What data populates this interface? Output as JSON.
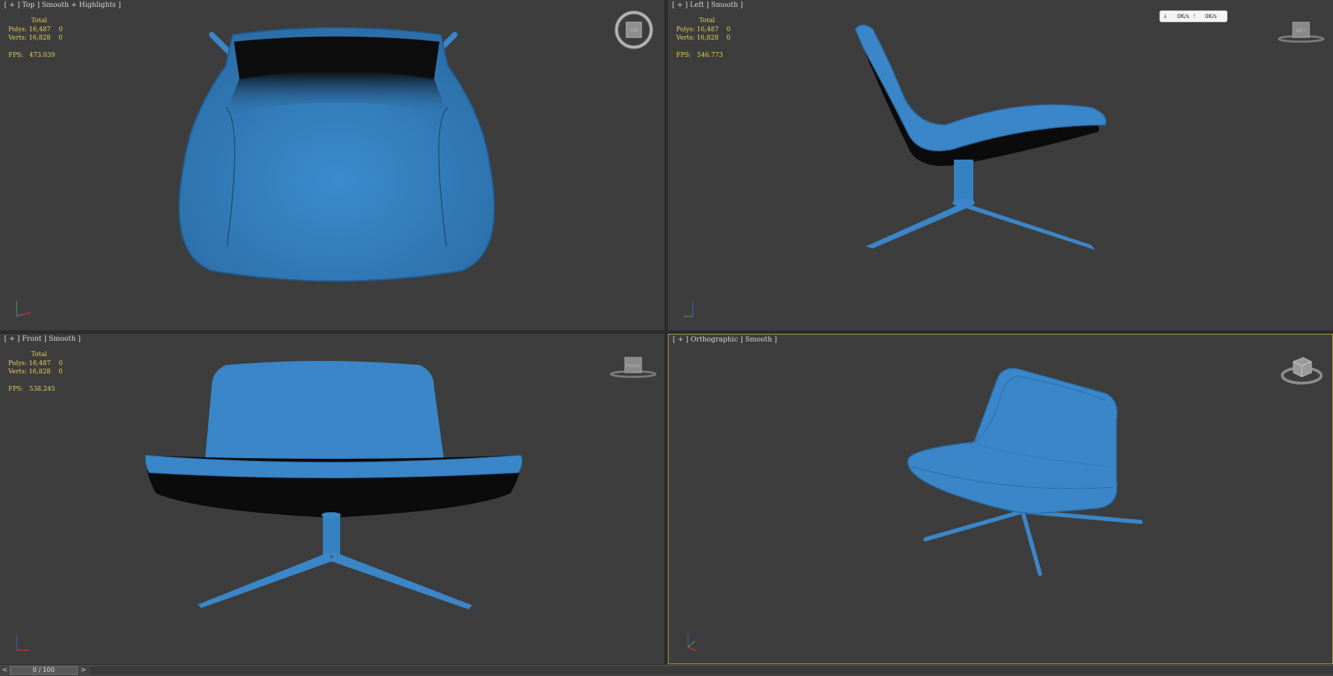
{
  "viewports": {
    "top": {
      "label_prefix": "[ + ] ",
      "view": "Top",
      "sep1": " ] ",
      "mode": "Smooth + Highlights",
      "suffix": " ]",
      "stats": {
        "header": "Total",
        "polys_label": "Polys:",
        "polys": "16,487",
        "polys_sel": "0",
        "verts_label": "Verts:",
        "verts": "16,828",
        "verts_sel": "0",
        "fps_label": "FPS:",
        "fps": "473.039"
      }
    },
    "left": {
      "label_prefix": "[ + ] ",
      "view": "Left",
      "sep1": " ] ",
      "mode": "Smooth",
      "suffix": " ]",
      "stats": {
        "header": "Total",
        "polys_label": "Polys:",
        "polys": "16,487",
        "polys_sel": "0",
        "verts_label": "Verts:",
        "verts": "16,828",
        "verts_sel": "0",
        "fps_label": "FPS:",
        "fps": "546.773"
      }
    },
    "front": {
      "label_prefix": "[ + ] ",
      "view": "Front",
      "sep1": " ] ",
      "mode": "Smooth",
      "suffix": " ]",
      "stats": {
        "header": "Total",
        "polys_label": "Polys:",
        "polys": "16,487",
        "polys_sel": "0",
        "verts_label": "Verts:",
        "verts": "16,828",
        "verts_sel": "0",
        "fps_label": "FPS:",
        "fps": "538.245"
      }
    },
    "persp": {
      "label_prefix": "[ + ] ",
      "view": "Orthographic",
      "sep1": " ] ",
      "mode": "Smooth",
      "suffix": " ]"
    }
  },
  "viewcube_labels": {
    "top": "TOP",
    "left": "LEFT",
    "front": "FRONT"
  },
  "network": {
    "down": "0K/s",
    "up": "0K/s"
  },
  "timeline": {
    "prev": "<",
    "next": ">",
    "frame": "0 / 100"
  },
  "colors": {
    "model": "#3a86c8",
    "model_dark": "#1e5b92",
    "background": "#3d3d3d",
    "stats": "#e6d35a",
    "active_border": "#b39b4a"
  }
}
